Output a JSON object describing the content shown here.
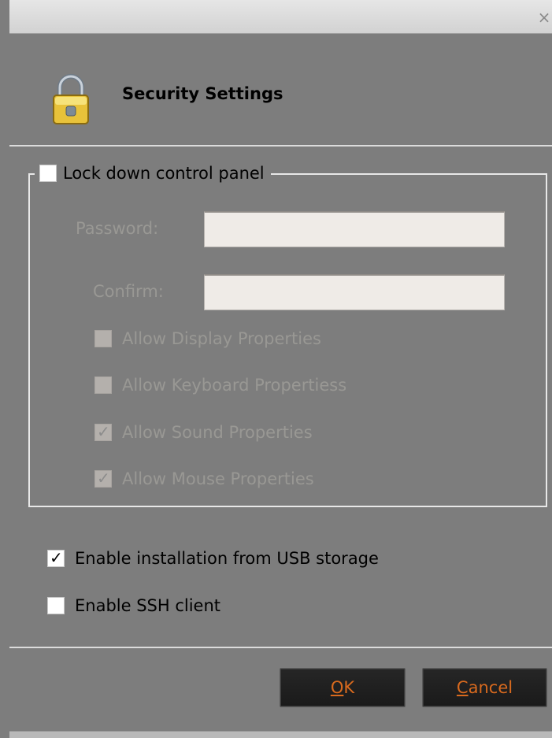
{
  "window": {
    "close_glyph": "×"
  },
  "header": {
    "title": "Security Settings",
    "icon": "lock-icon"
  },
  "lockdown": {
    "label": "Lock down control panel",
    "checked": false,
    "password_label": "Password:",
    "password_value": "",
    "confirm_label": "Confirm:",
    "confirm_value": "",
    "options": [
      {
        "label": "Allow Display Properties",
        "checked": false
      },
      {
        "label": "Allow Keyboard Propertiess",
        "checked": false
      },
      {
        "label": "Allow Sound Properties",
        "checked": true
      },
      {
        "label": "Allow Mouse Properties",
        "checked": true
      }
    ]
  },
  "settings": {
    "usb_label": "Enable installation from USB storage",
    "usb_checked": true,
    "ssh_label": "Enable SSH client",
    "ssh_checked": false
  },
  "buttons": {
    "ok_mnemonic": "O",
    "ok_rest": "K",
    "cancel_mnemonic": "C",
    "cancel_rest": "ancel"
  },
  "colors": {
    "button_text": "#d96a1e",
    "dialog_bg": "#7d7d7d"
  }
}
